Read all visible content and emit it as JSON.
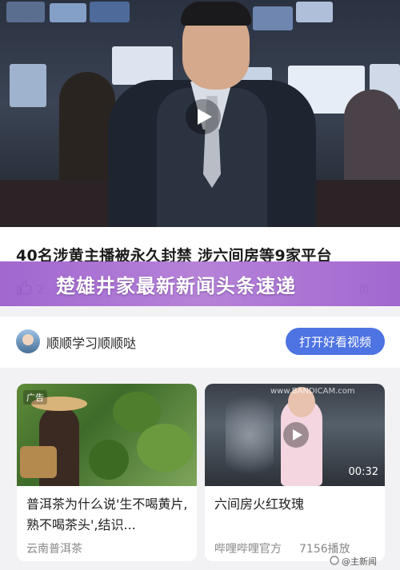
{
  "video": {
    "play_icon": "play-icon"
  },
  "article": {
    "title": "40名涉黄主播被永久封禁 涉六间房等9家平台",
    "like_count": "2",
    "like_icon": "thumbs-up-icon",
    "right_partial": "页"
  },
  "banner": {
    "text": "楚雄井家最新新闻头条速递",
    "color": "#9a5ccc"
  },
  "author": {
    "name": "顺顺学习顺顺哒",
    "open_button": "打开好看视频",
    "button_color": "#4e73e2"
  },
  "cards": [
    {
      "ad_tag": "广告",
      "title": "普洱茶为什么说'生不喝黄片,熟不喝茶头',结识...",
      "source": "云南普洱茶"
    },
    {
      "watermark": "www.BANDICAM.com",
      "duration": "00:32",
      "title": "六间房火红玫瑰",
      "source": "哔哩哔哩官方",
      "plays": "7156播放"
    }
  ],
  "footer": {
    "watermark": "@主新闻"
  }
}
